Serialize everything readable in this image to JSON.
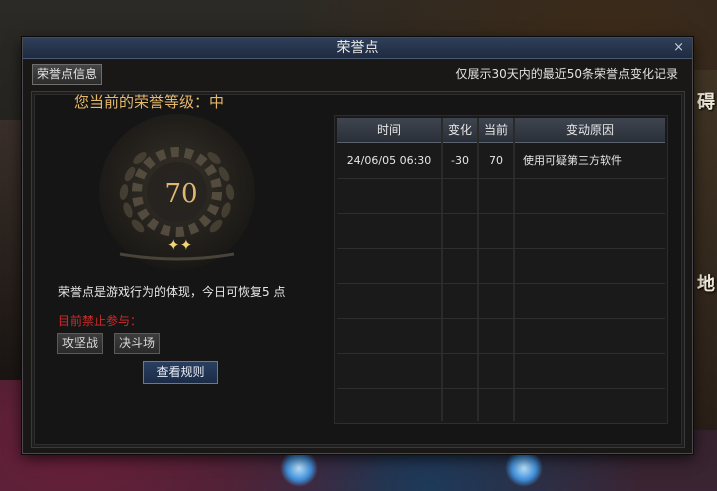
{
  "window": {
    "title": "荣誉点",
    "close_glyph": "×"
  },
  "tabs": [
    {
      "label": "荣誉点信息"
    }
  ],
  "notice": "仅展示30天内的最近50条荣誉点变化记录",
  "honor": {
    "level_text": "您当前的荣誉等级：中",
    "value": "70",
    "description": "荣誉点是游戏行为的体现，今日可恢复5 点",
    "forbidden_label": "目前禁止参与：",
    "forbidden_items": [
      "攻坚战",
      "决斗场"
    ],
    "rules_button": "查看规则"
  },
  "table": {
    "headers": [
      "时间",
      "变化",
      "当前",
      "变动原因"
    ],
    "rows": [
      {
        "time": "24/06/05 06:30",
        "change": "-30",
        "current": "70",
        "reason": "使用可疑第三方软件"
      }
    ]
  },
  "background": {
    "right_edge_texts": [
      "碍",
      "地"
    ]
  },
  "colors": {
    "accent_gold": "#e6b86a",
    "warning_red": "#d02b2b",
    "title_bar": "#2f3f5a"
  }
}
